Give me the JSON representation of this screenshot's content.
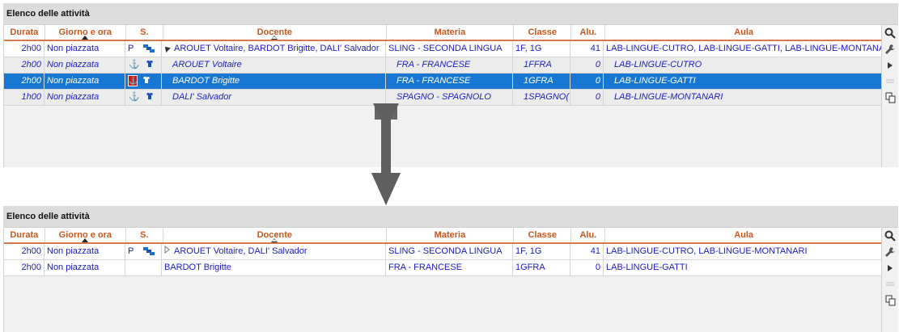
{
  "panel_title": "Elenco delle attività",
  "columns": {
    "durata": "Durata",
    "giorno": "Giorno e ora",
    "s": "S.",
    "docente": "Docente",
    "materia": "Materia",
    "classe": "Classe",
    "alu": "Alu.",
    "aula": "Aula"
  },
  "top": {
    "rows": [
      {
        "durata": "2h00",
        "giorno": "Non piazzata",
        "s": "P",
        "docente": "AROUET Voltaire, BARDOT Brigitte, DALI' Salvador",
        "materia": "SLING - SECONDA LINGUA",
        "classe": "1F, 1G",
        "alu": "41",
        "aula": "LAB-LINGUE-CUTRO, LAB-LINGUE-GATTI, LAB-LINGUE-MONTANARI"
      },
      {
        "durata": "2h00",
        "giorno": "Non piazzata",
        "docente": "AROUET Voltaire",
        "materia": "FRA - FRANCESE",
        "classe": "1FFRA",
        "alu": "0",
        "aula": "LAB-LINGUE-CUTRO"
      },
      {
        "durata": "2h00",
        "giorno": "Non piazzata",
        "docente": "BARDOT Brigitte",
        "materia": "FRA - FRANCESE",
        "classe": "1GFRA",
        "alu": "0",
        "aula": "LAB-LINGUE-GATTI"
      },
      {
        "durata": "1h00",
        "giorno": "Non piazzata",
        "docente": "DALI' Salvador",
        "materia": "SPAGNO - SPAGNOLO",
        "classe": "1SPAGNO(",
        "alu": "0",
        "aula": "LAB-LINGUE-MONTANARI"
      }
    ]
  },
  "bottom": {
    "rows": [
      {
        "durata": "2h00",
        "giorno": "Non piazzata",
        "s": "P",
        "docente": "AROUET Voltaire, DALI' Salvador",
        "materia": "SLING - SECONDA LINGUA",
        "classe": "1F, 1G",
        "alu": "41",
        "aula": "LAB-LINGUE-CUTRO, LAB-LINGUE-MONTANARI"
      },
      {
        "durata": "2h00",
        "giorno": "Non piazzata",
        "docente": "BARDOT Brigitte",
        "materia": "FRA - FRANCESE",
        "classe": "1GFRA",
        "alu": "0",
        "aula": "LAB-LINGUE-GATTI"
      }
    ]
  },
  "icons": [
    "search-icon",
    "wrench-icon",
    "play-icon",
    "copy-icon",
    "anchor-icon",
    "group-icon",
    "down-arrow-icon"
  ],
  "colors": {
    "header_text": "#c9571f",
    "row_text": "#1b1bc2",
    "selection": "#1877d3",
    "anchor": "#cc1a1a"
  }
}
